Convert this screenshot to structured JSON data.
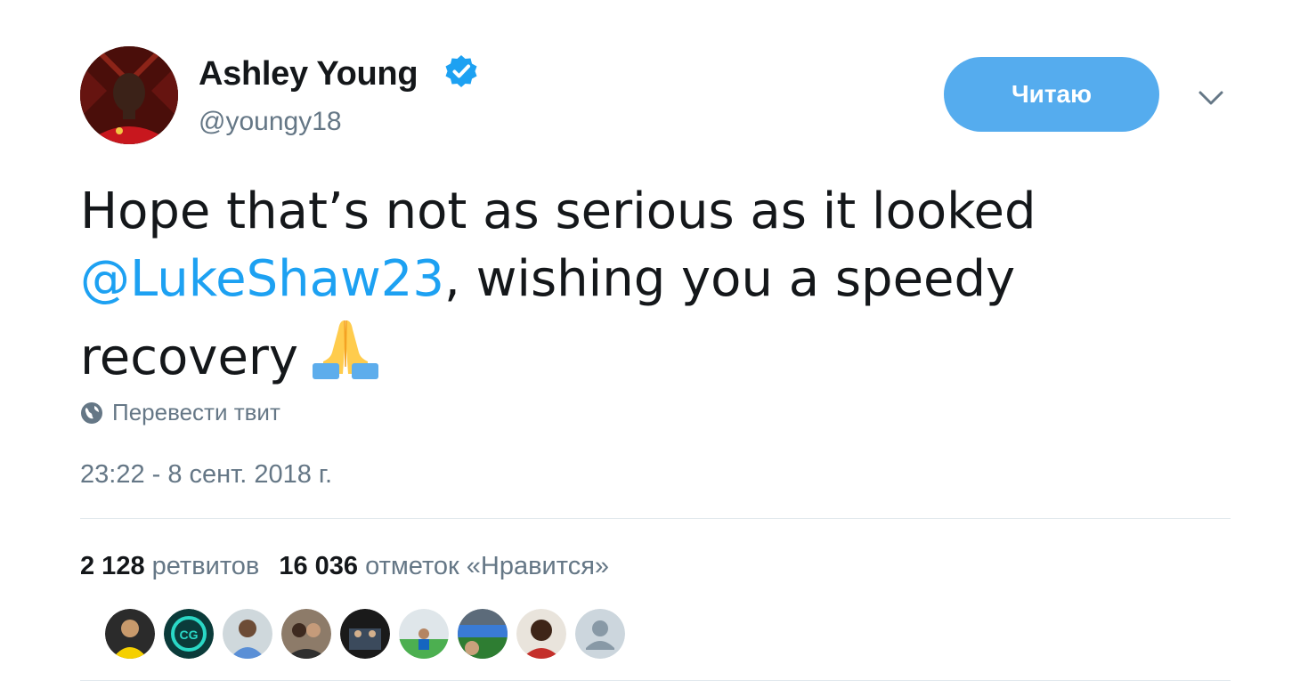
{
  "author": {
    "name": "Ashley Young",
    "handle": "@youngy18",
    "verified": true
  },
  "follow_button": {
    "label": "Читаю",
    "color": "#55acee"
  },
  "tweet": {
    "text_line1": "Hope that’s not as serious as it looked",
    "mention": "@LukeShaw23",
    "text_line2_rest": ", wishing you a speedy",
    "text_line3": "recovery",
    "emoji": "folded-hands-emoji"
  },
  "translate_label": "Перевести твит",
  "timestamp": "23:22 - 8 сент. 2018 г.",
  "stats": {
    "retweets_count": "2 128",
    "retweets_label": "ретвитов",
    "likes_count": "16 036",
    "likes_label": "отметок «Нравится»"
  },
  "likers": [
    {
      "icon": "liker-avatar-1"
    },
    {
      "icon": "liker-avatar-2"
    },
    {
      "icon": "liker-avatar-3"
    },
    {
      "icon": "liker-avatar-4"
    },
    {
      "icon": "liker-avatar-5"
    },
    {
      "icon": "liker-avatar-6"
    },
    {
      "icon": "liker-avatar-7"
    },
    {
      "icon": "liker-avatar-8"
    },
    {
      "icon": "default-avatar-icon"
    }
  ],
  "colors": {
    "link": "#1da1f2",
    "secondary_text": "#657786",
    "primary_text": "#14171a",
    "verified": "#1da1f2"
  }
}
